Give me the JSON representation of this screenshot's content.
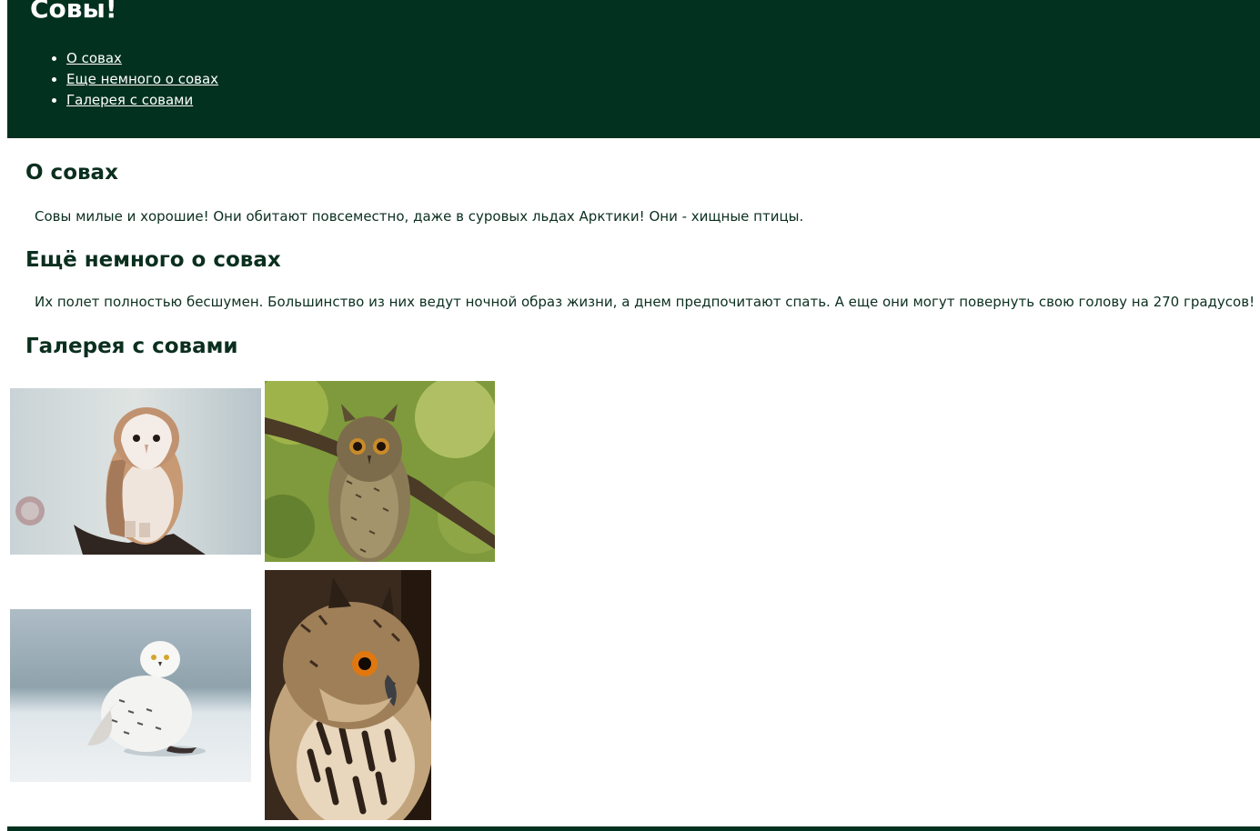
{
  "header": {
    "title": "Совы!",
    "nav": [
      {
        "label": "О совах"
      },
      {
        "label": "Еще немного о совах"
      },
      {
        "label": "Галерея с совами"
      }
    ]
  },
  "sections": [
    {
      "title": "О совах",
      "text": "Совы милые и хорошие! Они обитают повсеместно, даже в суровых льдах Арктики! Они - хищные птицы."
    },
    {
      "title": "Ещё немного о совах",
      "text": "Их полет полностью бесшумен. Большинство из них ведут ночной образ жизни, а днем предпочитают спать. А еще они могут повернуть свою голову на 270 градусов!"
    },
    {
      "title": "Галерея с совами"
    }
  ],
  "gallery": [
    {
      "subject": "barn-owl"
    },
    {
      "subject": "long-eared-owl"
    },
    {
      "subject": "snowy-owl"
    },
    {
      "subject": "eagle-owl"
    }
  ],
  "colors": {
    "header_bg": "#033120",
    "text": "#0b2f1f",
    "link": "#ffffff"
  }
}
